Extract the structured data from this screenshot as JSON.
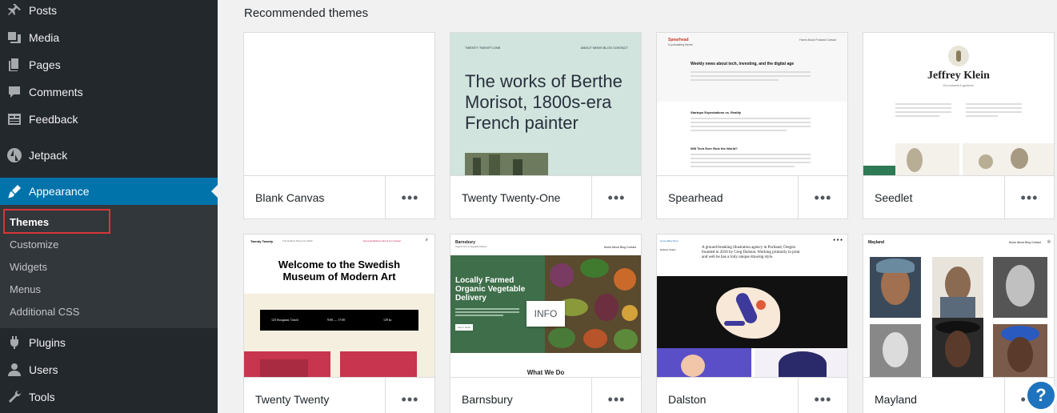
{
  "sidebar": {
    "items": [
      {
        "label": "Posts",
        "icon": "pin-icon"
      },
      {
        "label": "Media",
        "icon": "media-icon"
      },
      {
        "label": "Pages",
        "icon": "pages-icon"
      },
      {
        "label": "Comments",
        "icon": "comments-icon"
      },
      {
        "label": "Feedback",
        "icon": "feedback-icon"
      },
      {
        "label": "Jetpack",
        "icon": "jetpack-icon"
      },
      {
        "label": "Appearance",
        "icon": "brush-icon"
      },
      {
        "label": "Plugins",
        "icon": "plugin-icon"
      },
      {
        "label": "Users",
        "icon": "users-icon"
      },
      {
        "label": "Tools",
        "icon": "wrench-icon"
      }
    ],
    "submenu": [
      "Themes",
      "Customize",
      "Widgets",
      "Menus",
      "Additional CSS"
    ]
  },
  "main": {
    "section_title": "Recommended themes",
    "more_label": "•••",
    "info_label": "INFO",
    "help_label": "?",
    "themes": [
      {
        "name": "Blank Canvas"
      },
      {
        "name": "Twenty Twenty-One"
      },
      {
        "name": "Spearhead"
      },
      {
        "name": "Seedlet"
      },
      {
        "name": "Twenty Twenty"
      },
      {
        "name": "Barnsbury"
      },
      {
        "name": "Dalston"
      },
      {
        "name": "Mayland"
      }
    ],
    "previews": {
      "tto_header": "TWENTY TWENTY-ONE",
      "tto_nav": "ABOUT   NEWS   BLOG   CONTACT",
      "tto_heading": "The works of Berthe Morisot, 1800s-era French painter",
      "spear_logo": "Spearhead",
      "spear_tag": "A podcasting theme",
      "spear_nav": "Home  About  Podcast  Contact",
      "spear_h1": "Weekly news about tech, investing, and the digital age",
      "spear_h2": "Startups Expectations vs. Reality",
      "spear_h3": "Will Tech Ever Rule the World?",
      "seed_name": "Jeffrey Klein",
      "seed_sub": "Eco-botanist & gardener",
      "tt_logo": "Twenty Twenty",
      "tt_tagline": "The Default Theme for 2020",
      "tt_nav": "Home   Exhibitions   About Us   Contact",
      "tt_heading": "Welcome to the Swedish Museum of Modern Art",
      "tt_addr": "123 Storgatan, Umeå",
      "tt_hours": "9:00 — 17:00",
      "tt_price": "129 kr",
      "barn_logo": "Barnsbury",
      "barn_tag": "Organic Farm & Vegetable Delivery",
      "barn_nav": "Home  About  Blog  Contact",
      "barn_heading": "Locally Farmed Organic Vegetable Delivery",
      "barn_btn": "Get in touch",
      "barn_bottom": "What We Do",
      "dal_logo": "Dalston Studio",
      "dal_nav": "Home  Blog  Shop",
      "dal_text": "A ground-breaking illustration agency in Portland, Oregon founded in 2010 by Greg Dalston. Working primarily in print and web he has a truly unique drawing style.",
      "may_logo": "Mayland",
      "may_nav": "Home  About  Blog  Contact"
    }
  }
}
